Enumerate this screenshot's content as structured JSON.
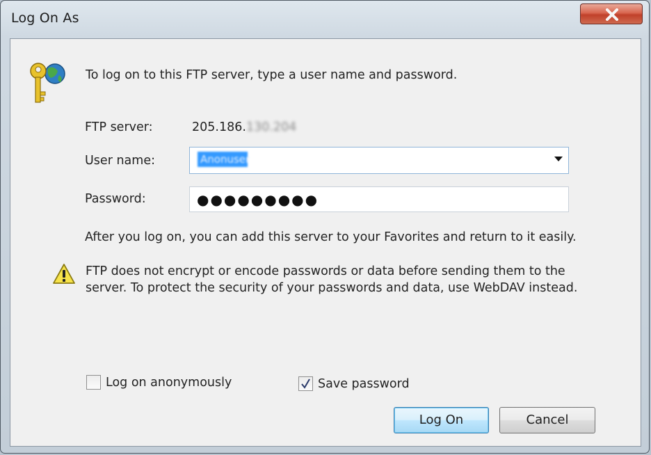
{
  "window": {
    "title": "Log On As"
  },
  "intro": "To log on to this FTP server, type a user name and password.",
  "server": {
    "label": "FTP server:",
    "value_visible": "205.186.",
    "value_hidden": "130.204"
  },
  "username": {
    "label": "User name:",
    "value": "Anonuser"
  },
  "password": {
    "label": "Password:",
    "masked": "●●●●●●●●●"
  },
  "info": "After you log on, you can add this server to your Favorites and return to it easily.",
  "warning": {
    "line1": "FTP does not encrypt or encode passwords or data before sending them to the",
    "line2": "server.  To protect the security of your passwords and data, use WebDAV instead."
  },
  "options": {
    "anonymous_label": "Log on anonymously",
    "anonymous_checked": false,
    "save_label": "Save password",
    "save_checked": true
  },
  "buttons": {
    "logon": "Log On",
    "cancel": "Cancel"
  },
  "colors": {
    "accent": "#3399ff",
    "close": "#c0402a",
    "default_button": "#bee6fd"
  }
}
